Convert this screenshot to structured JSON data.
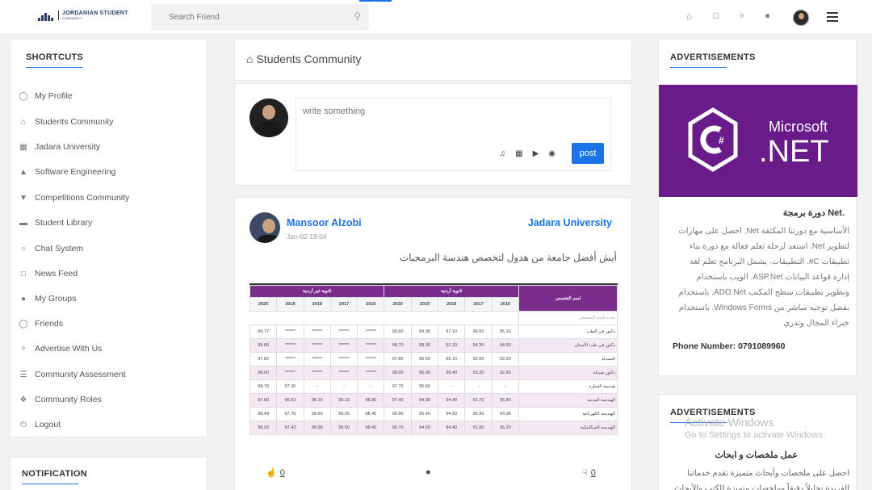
{
  "brand": {
    "name_line1": "JORDANIAN STUDENT",
    "name_line2": "COMMUNITY"
  },
  "search": {
    "placeholder": "Search Friend",
    "icon": "search-icon"
  },
  "topnav": {
    "icons": [
      "home-icon",
      "comment-icon",
      "bell-icon",
      "globe-icon",
      "avatar",
      "menu-icon"
    ]
  },
  "shortcuts": {
    "title": "SHORTCUTS",
    "items": [
      {
        "label": "My Profile",
        "icon": "mouse-icon"
      },
      {
        "label": "Students Community",
        "icon": "home-icon"
      },
      {
        "label": "Jadara University",
        "icon": "university-icon"
      },
      {
        "label": "Software Engineering",
        "icon": "graduation-cap-icon"
      },
      {
        "label": "Competitions Community",
        "icon": "trophy-icon"
      },
      {
        "label": "Student Library",
        "icon": "briefcase-icon"
      },
      {
        "label": "Chat System",
        "icon": "chat-icon"
      },
      {
        "label": "News Feed",
        "icon": "newspaper-icon"
      },
      {
        "label": "My Groups",
        "icon": "users-icon"
      },
      {
        "label": "Friends",
        "icon": "user-icon"
      },
      {
        "label": "Advertise With Us",
        "icon": "lightbulb-icon"
      },
      {
        "label": "Community Assessment",
        "icon": "list-icon"
      },
      {
        "label": "Community Roles",
        "icon": "handshake-icon"
      },
      {
        "label": "Logout",
        "icon": "power-icon"
      }
    ]
  },
  "notification": {
    "title": "NOTIFICATION"
  },
  "community": {
    "title": "Students Community"
  },
  "composer": {
    "placeholder": "write something",
    "post_label": "post",
    "tools": [
      "music-icon",
      "image-icon",
      "video-icon",
      "camera-icon"
    ]
  },
  "post": {
    "author": "Mansoor Alzobi",
    "date": "Jan-02 19:04",
    "university": "Jadara University",
    "text": "أيش أفضل جامعة من هدول لتخصص هندسة البرمجيات",
    "likes": "0",
    "dislikes": "0",
    "table": {
      "group_private": "ثانوية غير أردنية",
      "group_jordan": "ثانوية أردنية",
      "major_header": "اسم التخصص",
      "years": [
        "2020",
        "2019",
        "2018",
        "2017",
        "2016"
      ],
      "search_hint": "بحث باسم التخصص",
      "rows": [
        {
          "name": "دكتور في الطب",
          "alt": false,
          "vals": [
            "99.77",
            "******",
            "******",
            "******",
            "******",
            "99.60",
            "99.00",
            "97.10",
            "96.60",
            "95.10"
          ]
        },
        {
          "name": "دكتور في طب الأسنان",
          "alt": true,
          "vals": [
            "99.00",
            "******",
            "******",
            "******",
            "******",
            "98.70",
            "98.00",
            "91.10",
            "94.30",
            "94.60"
          ]
        },
        {
          "name": "الصيدلة",
          "alt": false,
          "vals": [
            "97.82",
            "******",
            "******",
            "******",
            "******",
            "97.80",
            "96.50",
            "95.10",
            "92.60",
            "92.20"
          ]
        },
        {
          "name": "دكتور صيدلة",
          "alt": true,
          "vals": [
            "98.00",
            "******",
            "******",
            "******",
            "******",
            "98.00",
            "96.90",
            "95.40",
            "93.30",
            "92.60"
          ]
        },
        {
          "name": "هندسة العمارة",
          "alt": false,
          "vals": [
            "98.79",
            "97.30",
            "-",
            "-",
            "-",
            "97.70",
            "95.60",
            "-",
            "-",
            "-"
          ]
        },
        {
          "name": "الهندسة المدنية",
          "alt": true,
          "vals": [
            "97.60",
            "96.53",
            "98.10",
            "99.10",
            "98.80",
            "97.40",
            "94.90",
            "94.40",
            "91.70",
            "95.80"
          ]
        },
        {
          "name": "الهندسة الكهربائية",
          "alt": false,
          "vals": [
            "98.44",
            "97.70",
            "98.60",
            "99.00",
            "98.40",
            "96.80",
            "95.40",
            "94.50",
            "92.30",
            "94.30"
          ]
        },
        {
          "name": "الهندسة الميكانيكية",
          "alt": true,
          "vals": [
            "98.20",
            "97.43",
            "98.98",
            "98.50",
            "98.40",
            "96.70",
            "94.60",
            "94.40",
            "91.80",
            "95.20"
          ]
        }
      ]
    }
  },
  "ads": {
    "title": "ADVERTISEMENTS",
    "ad1": {
      "banner_line1": "Microsoft",
      "banner_line2": ".NET",
      "banner_colour": "#6a1b8a",
      "title": ".Net دورة برمجة",
      "body": "الأساسية مع دورتنا المكثفة Net. احصل على مهارات لتطوير Net. استعد لرحلة تعلم فعالة مع دورة بناء تطبيقات C#. التطبيقات. يشمل البرنامج تعلم لغة إدارة قواعد البيانات ASP.Net. الويب باستخدام وتطوير تطبيقات سطح المكتب ADO.Net. باستخدام بفضل توجيه مباشر من Windows Forms. باستخدام خبراء المجال وتدري",
      "phone": "Phone Number: 0791089960"
    },
    "ad2": {
      "title": "عمل ملخصات و ابحاث",
      "body": "احصل على ملخصات وأبحاث متميزة تقدم خدماتنا الفريدة تحليلاً دقيقاً وملخصات متميزة للكتب والأبحاث"
    }
  },
  "watermark": {
    "line1": "Activate Windows",
    "line2": "Go to Settings to activate Windows."
  }
}
